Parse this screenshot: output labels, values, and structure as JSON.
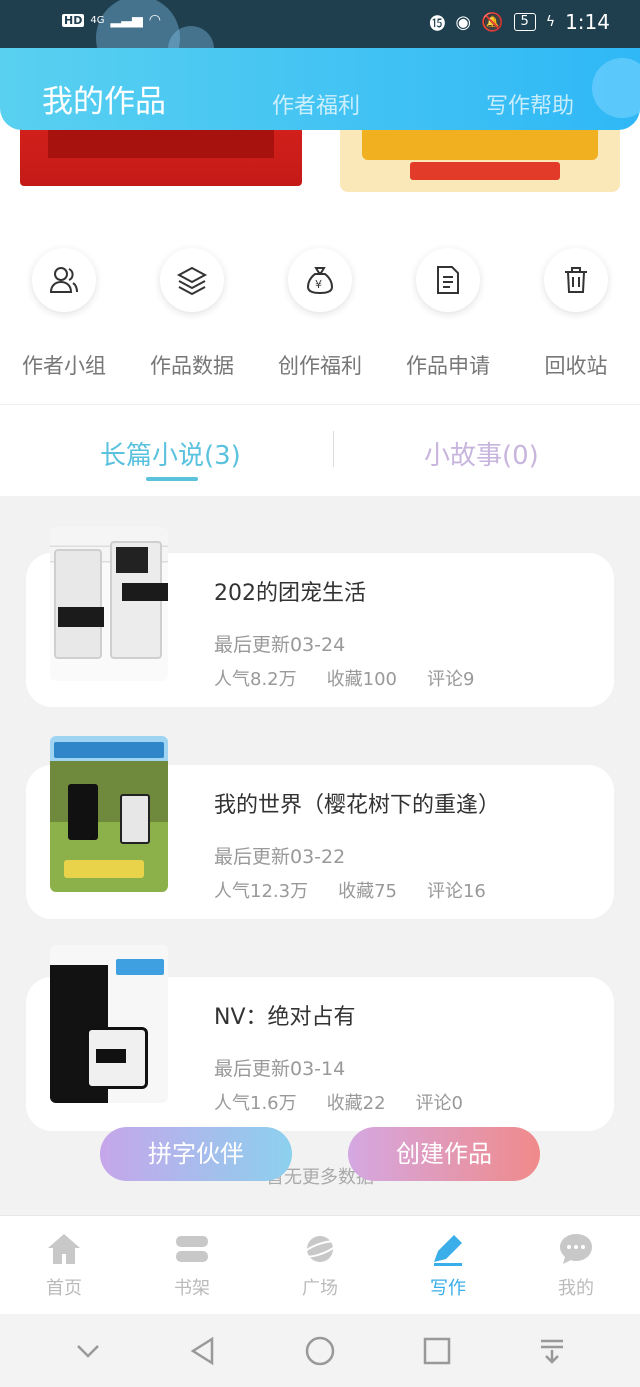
{
  "status_bar": {
    "network": "HD",
    "signal": "4G",
    "battery": "5",
    "time": "1:14"
  },
  "header": {
    "tab_main": "我的作品",
    "tab_welfare": "作者福利",
    "tab_help": "写作帮助"
  },
  "quick_actions": [
    {
      "label": "作者小组",
      "icon": "group-icon"
    },
    {
      "label": "作品数据",
      "icon": "layers-icon"
    },
    {
      "label": "创作福利",
      "icon": "money-bag-icon"
    },
    {
      "label": "作品申请",
      "icon": "document-icon"
    },
    {
      "label": "回收站",
      "icon": "trash-icon"
    }
  ],
  "tabs": {
    "novel": "长篇小说(3)",
    "story": "小故事(0)"
  },
  "works": [
    {
      "title": "202的团宠生活",
      "updated": "最后更新03-24",
      "popularity": "人气8.2万",
      "favorites": "收藏100",
      "comments": "评论9"
    },
    {
      "title": "我的世界（樱花树下的重逢）",
      "updated": "最后更新03-22",
      "popularity": "人气12.3万",
      "favorites": "收藏75",
      "comments": "评论16"
    },
    {
      "title": "NV：绝对占有",
      "updated": "最后更新03-14",
      "popularity": "人气1.6万",
      "favorites": "收藏22",
      "comments": "评论0"
    }
  ],
  "buttons": {
    "pinzi": "拼字伙伴",
    "create": "创建作品"
  },
  "no_more": "暂无更多数据",
  "bottom_nav": [
    {
      "label": "首页",
      "icon": "home-icon"
    },
    {
      "label": "书架",
      "icon": "bookshelf-icon"
    },
    {
      "label": "广场",
      "icon": "planet-icon"
    },
    {
      "label": "写作",
      "icon": "pen-icon"
    },
    {
      "label": "我的",
      "icon": "chat-icon"
    }
  ],
  "colors": {
    "accent": "#3aaee8",
    "header_start": "#59d0f0",
    "header_end": "#2fb8f6",
    "tab_active": "#5bc2de"
  }
}
